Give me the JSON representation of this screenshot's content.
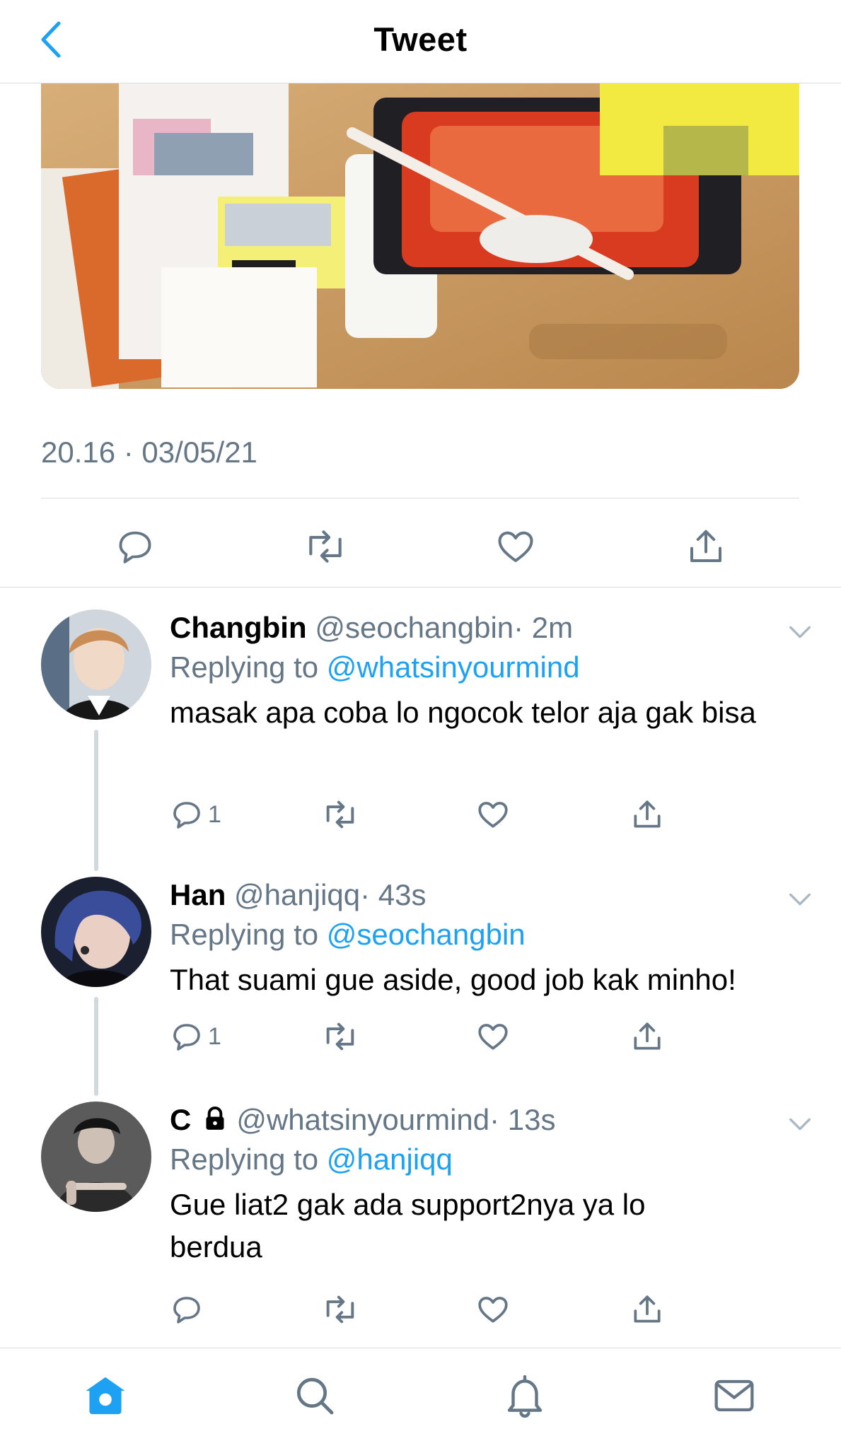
{
  "header": {
    "title": "Tweet"
  },
  "tweet": {
    "timestamp": "20.16 · 03/05/21"
  },
  "colors": {
    "accent": "#1da1f2",
    "muted": "#657786",
    "divider": "#d9dde0"
  },
  "replies": [
    {
      "name": "Changbin",
      "handle": "@seochangbin",
      "time": "· 2m",
      "replying_prefix": "Replying to",
      "replying_to": "@whatsinyourmind",
      "text": "masak apa coba lo ngocok telor aja gak bisa",
      "reply_count": "1",
      "locked": false
    },
    {
      "name": "Han",
      "handle": "@hanjiqq",
      "time": "· 43s",
      "replying_prefix": "Replying to",
      "replying_to": "@seochangbin",
      "text": "That suami gue aside, good job kak minho!",
      "reply_count": "1",
      "locked": false
    },
    {
      "name": "C",
      "handle": "@whatsinyourmind",
      "time": "· 13s",
      "replying_prefix": "Replying to",
      "replying_to": "@hanjiqq",
      "text": "Gue liat2 gak ada support2nya ya lo berdua",
      "reply_count": "",
      "locked": true
    }
  ],
  "tabs": [
    {
      "icon": "home-icon",
      "active": true
    },
    {
      "icon": "search-icon",
      "active": false
    },
    {
      "icon": "bell-icon",
      "active": false
    },
    {
      "icon": "mail-icon",
      "active": false
    }
  ]
}
